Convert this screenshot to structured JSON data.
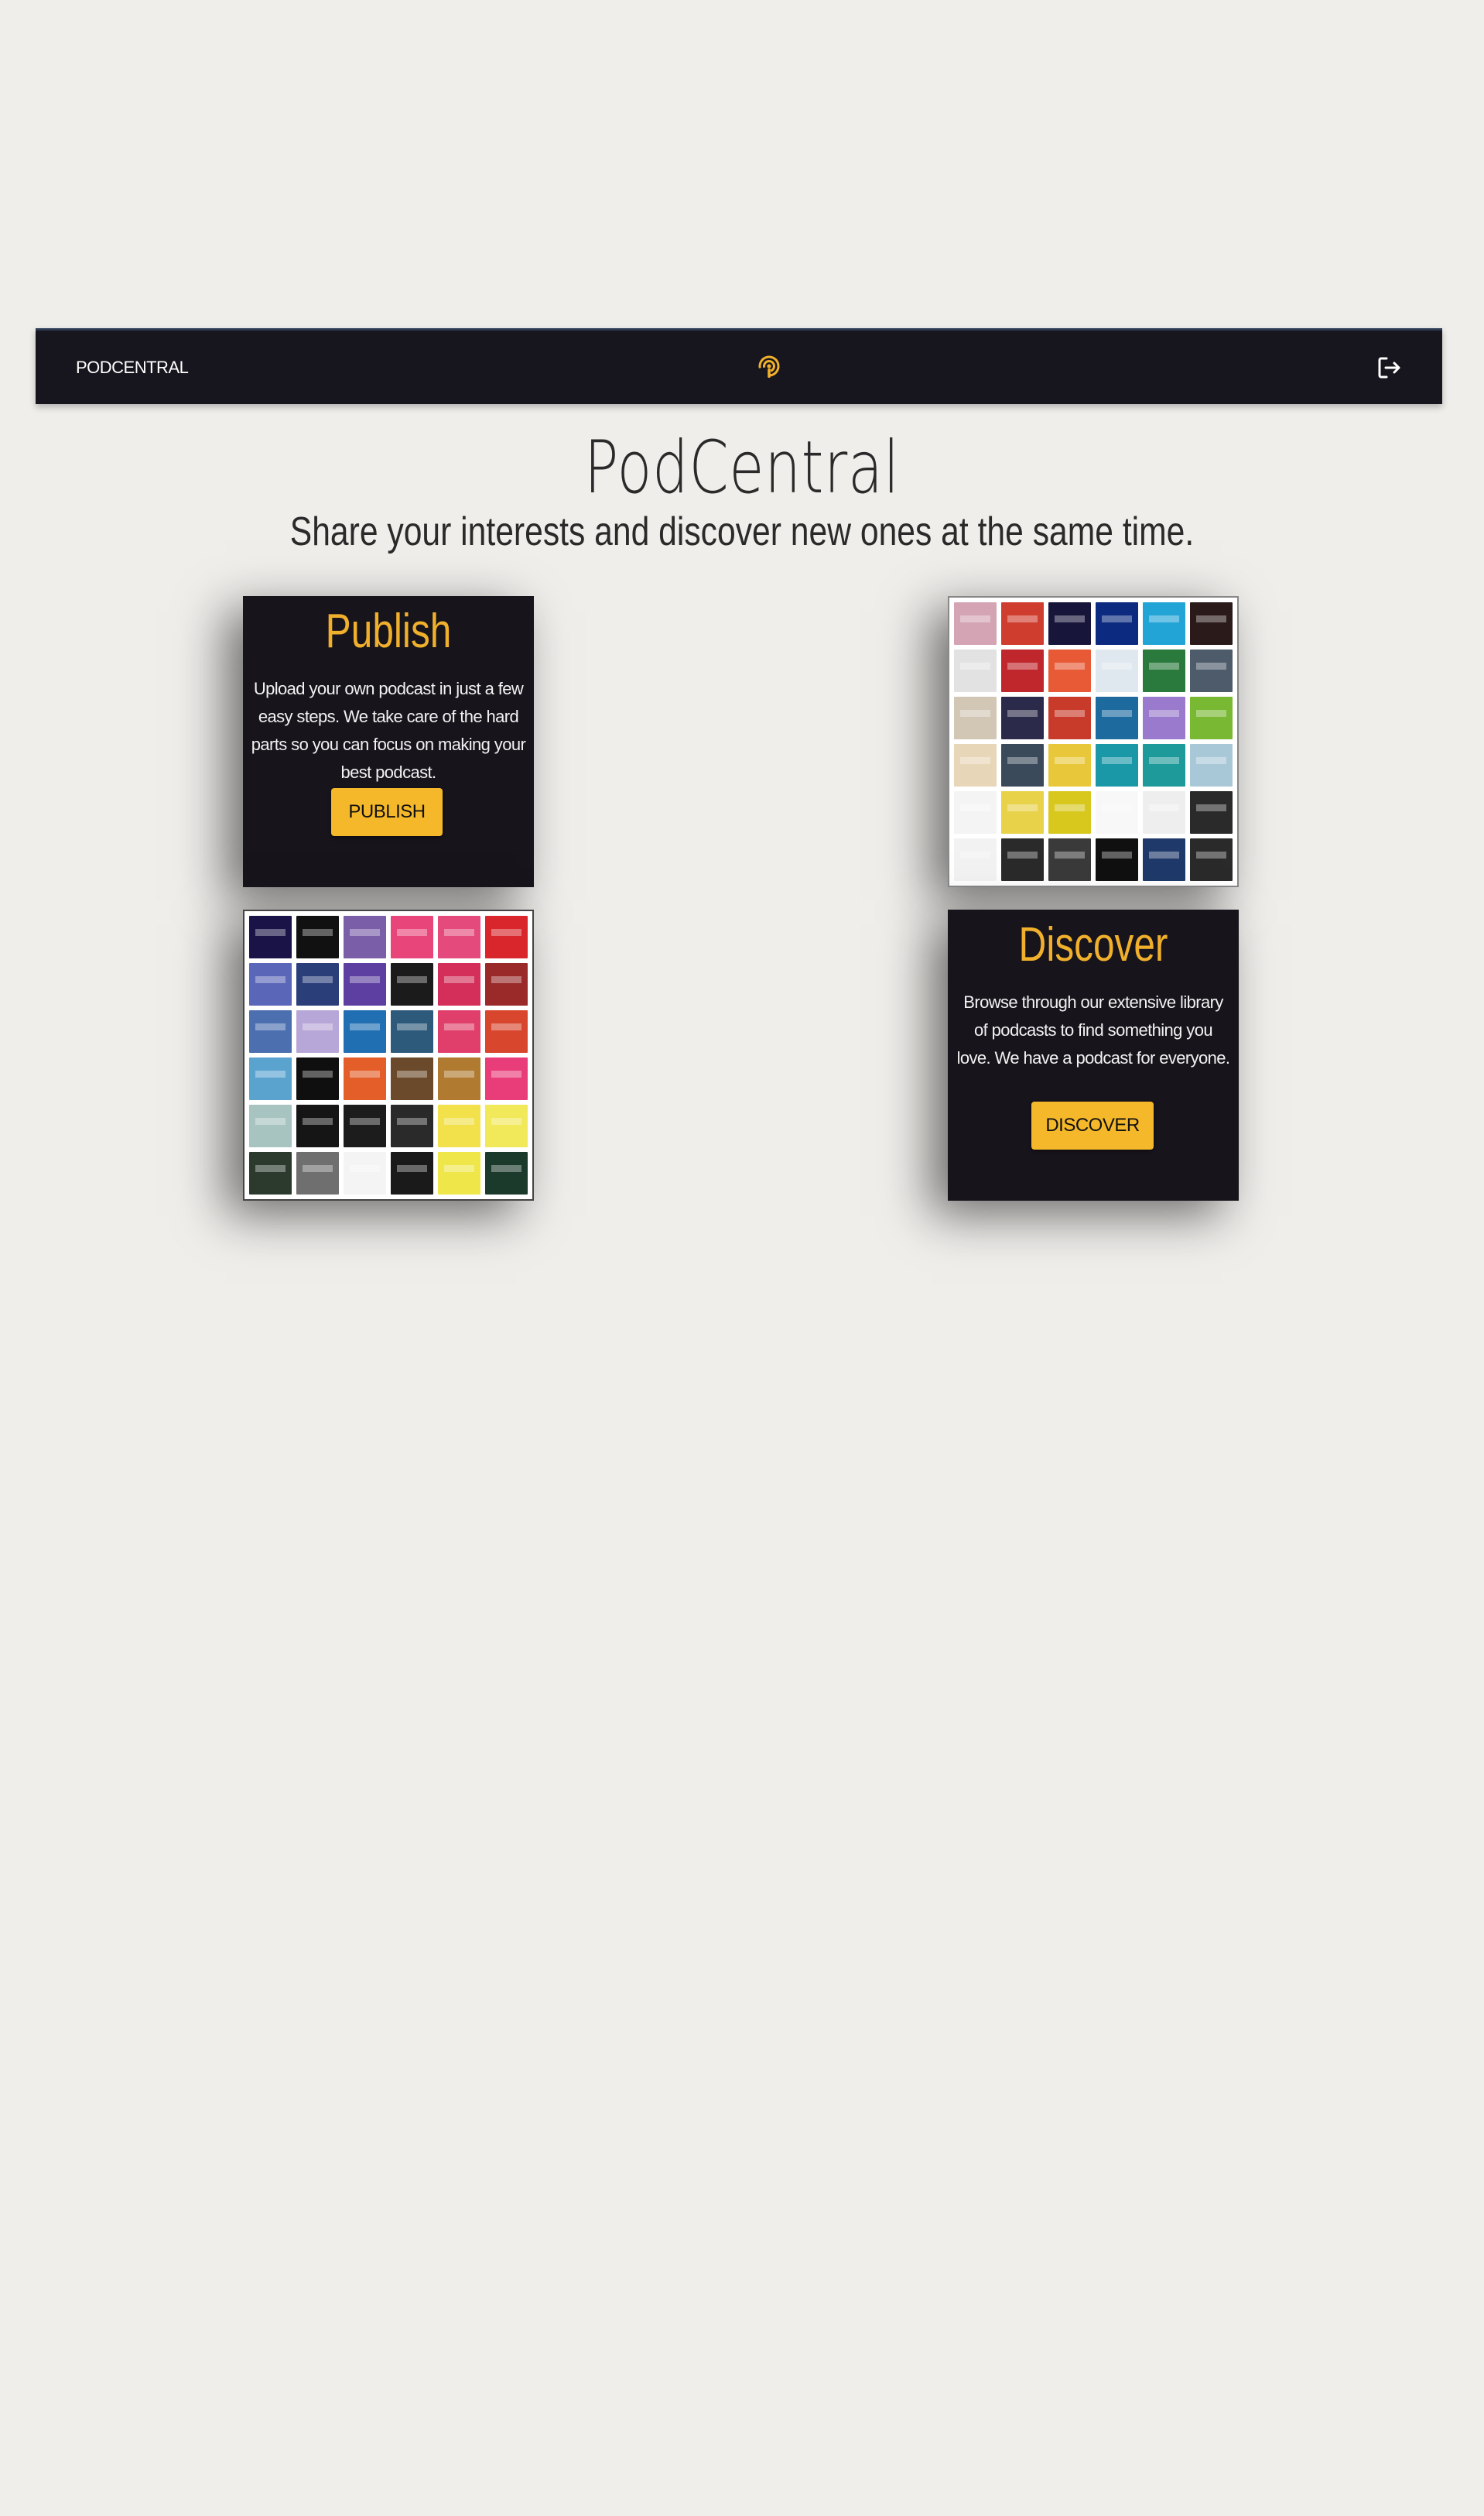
{
  "navbar": {
    "brand": "PODCENTRAL",
    "center_icon": "podcast-icon",
    "right_icon": "logout-icon",
    "accent": "#f0b02c"
  },
  "hero": {
    "title": "PodCentral",
    "subtitle": "Share your interests and discover new ones at the same time."
  },
  "publish_card": {
    "title": "Publish",
    "text": "Upload your own podcast in just a few easy steps. We take care of the hard parts so you can focus on making your best podcast.",
    "button": "PUBLISH"
  },
  "discover_card": {
    "title": "Discover",
    "text": "Browse through our extensive library of podcasts to find something you love. We have a podcast for everyone.",
    "button": "DISCOVER"
  },
  "colors": {
    "background": "#efeeeb",
    "card_dark": "#17141b",
    "button": "#f5b82a"
  },
  "collage_left": {
    "tiles": [
      "#1a1347",
      "#111111",
      "#7a5ea8",
      "#e8457a",
      "#e44b7c",
      "#d9262c",
      "#5a66b8",
      "#2a3e7a",
      "#5c3fa0",
      "#1b1b1b",
      "#d32f5a",
      "#9a2a2a",
      "#4c6fb0",
      "#b7a7d8",
      "#1f6fb2",
      "#2d5a7a",
      "#e03f6b",
      "#d7462d",
      "#5aa3cf",
      "#0f0f0f",
      "#e45e2a",
      "#6a4a2a",
      "#b07a30",
      "#e93d7a",
      "#a8c4c0",
      "#151515",
      "#1c1c1c",
      "#2a2a2a",
      "#f2e14a",
      "#f1e95a",
      "#2c3a2e",
      "#6f6f6f",
      "#f4f4f4",
      "#1a1a1a",
      "#efe64a",
      "#1c3a2c"
    ]
  },
  "collage_right": {
    "tiles": [
      "#d5a4b4",
      "#cf3d2f",
      "#17153a",
      "#0b2a80",
      "#23a4d6",
      "#2a1a1a",
      "#e2e2e2",
      "#c0272d",
      "#e85a36",
      "#dfe7ef",
      "#2a7a3e",
      "#4d5b6a",
      "#d2c6b4",
      "#2b2a4a",
      "#c83a2a",
      "#1c6a9e",
      "#9a7acc",
      "#78b832",
      "#e8d6b8",
      "#3a4a5a",
      "#e8c83a",
      "#1a98a8",
      "#1f9a9a",
      "#a8c8d8",
      "#f4f4f4",
      "#e8d24a",
      "#d8c81e",
      "#f8f8f8",
      "#eeeeee",
      "#2a2a2a",
      "#f2f2f2",
      "#2a2a2a",
      "#3a3a3a",
      "#101010",
      "#1f3a6a",
      "#2a2a2a"
    ]
  }
}
